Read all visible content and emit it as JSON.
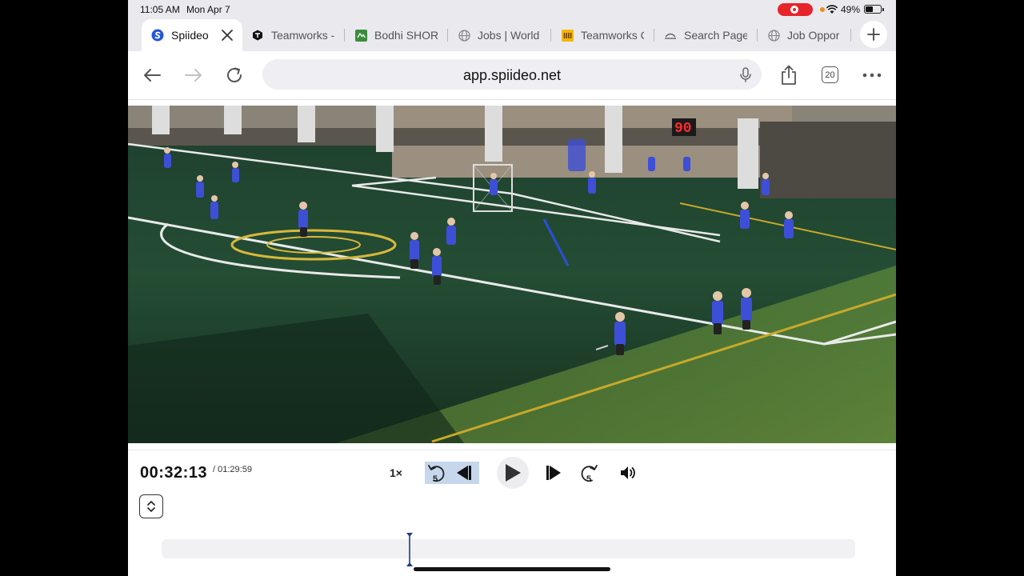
{
  "status_bar": {
    "time": "11:05 AM",
    "date": "Mon Apr 7",
    "battery_percent": "49%",
    "battery_level": 0.49,
    "recording_color": "#e8242b"
  },
  "tabs": [
    {
      "label": "Spiideo",
      "active": true,
      "icon": "spiideo-logo-icon"
    },
    {
      "label": "Teamworks -",
      "active": false,
      "icon": "teamworks-logo-icon"
    },
    {
      "label": "Bodhi SHORT",
      "active": false,
      "icon": "bodhi-logo-icon"
    },
    {
      "label": "Jobs | World",
      "active": false,
      "icon": "globe-icon"
    },
    {
      "label": "Teamworks C",
      "active": false,
      "icon": "teamworks-yellow-logo-icon"
    },
    {
      "label": "Search Page",
      "active": false,
      "icon": "search-page-icon"
    },
    {
      "label": "Job Oppor",
      "active": false,
      "icon": "globe-icon"
    }
  ],
  "toolbar": {
    "url": "app.spiideo.net",
    "tab_count": "20",
    "icons": [
      "back-arrow-icon",
      "forward-arrow-icon",
      "reload-icon",
      "microphone-icon",
      "share-icon",
      "tabs-icon",
      "more-icon"
    ]
  },
  "video": {
    "scoreboard": "90"
  },
  "player": {
    "current_time": "00:32:13",
    "duration": "/ 01:29:59",
    "speed": "1×",
    "skip_back_seconds": "5",
    "skip_forward_seconds": "5",
    "progress_fraction": 0.358,
    "accent_color": "#1f3c8a"
  }
}
